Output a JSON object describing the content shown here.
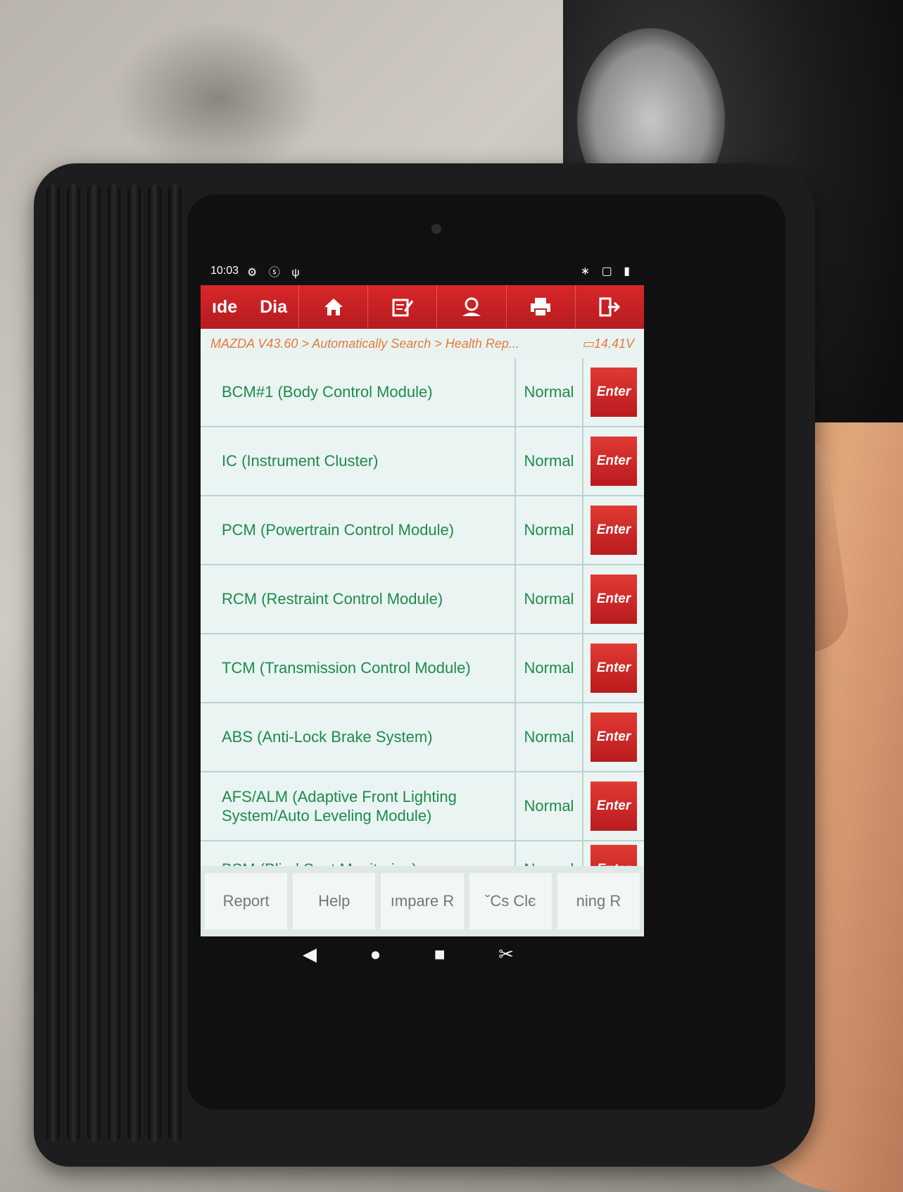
{
  "status_bar": {
    "time": "10:03",
    "left_icons": "⚙ ⓢ ψ",
    "right_icons": "∗ ▢ ▮"
  },
  "toolbar": {
    "tabs": [
      "ıde",
      "Dia"
    ],
    "buttons": [
      {
        "icon": "home-icon",
        "glyph": "⌂"
      },
      {
        "icon": "edit-note-icon",
        "glyph": "✎"
      },
      {
        "icon": "user-support-icon",
        "glyph": "☺"
      },
      {
        "icon": "printer-icon",
        "glyph": "⎙"
      },
      {
        "icon": "exit-icon",
        "glyph": "⇥"
      }
    ]
  },
  "breadcrumb": {
    "path": "MAZDA V43.60 > Automatically Search > Health Rep...",
    "voltage": "14.41V"
  },
  "modules": [
    {
      "name": "BCM#1 (Body Control Module)",
      "status": "Normal",
      "action": "Enter"
    },
    {
      "name": "IC (Instrument Cluster)",
      "status": "Normal",
      "action": "Enter"
    },
    {
      "name": "PCM (Powertrain Control Module)",
      "status": "Normal",
      "action": "Enter"
    },
    {
      "name": "RCM (Restraint Control Module)",
      "status": "Normal",
      "action": "Enter"
    },
    {
      "name": "TCM (Transmission Control Module)",
      "status": "Normal",
      "action": "Enter"
    },
    {
      "name": "ABS (Anti-Lock Brake System)",
      "status": "Normal",
      "action": "Enter"
    },
    {
      "name": "AFS/ALM (Adaptive Front Lighting System/Auto Leveling Module)",
      "status": "Normal",
      "action": "Enter"
    },
    {
      "name": "BSM (Blind Spot Monitoring)",
      "status": "Normal",
      "action": "Enter"
    }
  ],
  "bottom_bar": [
    "Report",
    "Help",
    "ımpare R",
    "ˇCs    Clє",
    "ning    R"
  ],
  "nav_bar": {
    "back": "◀",
    "home": "●",
    "recents": "■",
    "screenshot": "✂"
  },
  "colors": {
    "toolbar_red": "#c8211f",
    "text_green": "#1e8a4d",
    "breadcrumb_orange": "#e57a3a"
  }
}
